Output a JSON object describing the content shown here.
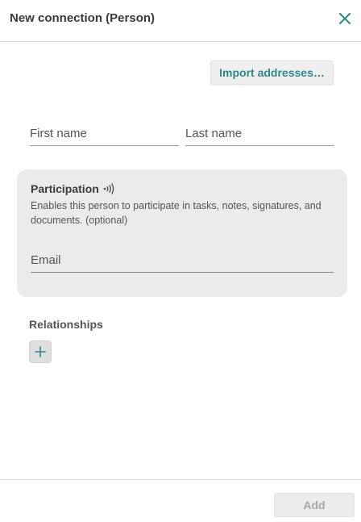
{
  "dialog": {
    "title": "New connection (Person)",
    "close_icon": "close-icon"
  },
  "toolbar": {
    "import_label": "Import addresses…"
  },
  "name": {
    "first_placeholder": "First name",
    "first_value": "",
    "last_placeholder": "Last name",
    "last_value": ""
  },
  "participation": {
    "title": "Participation",
    "icon": "signal-icon",
    "description": "Enables this person to participate in tasks, notes, signatures, and documents. (optional)",
    "email_placeholder": "Email",
    "email_value": ""
  },
  "relationships": {
    "title": "Relationships",
    "add_icon": "plus-icon"
  },
  "footer": {
    "add_label": "Add",
    "add_disabled": true
  },
  "colors": {
    "accent": "#2a8a8a",
    "panel_bg": "#ebebeb",
    "divider": "#d9d9d9"
  }
}
